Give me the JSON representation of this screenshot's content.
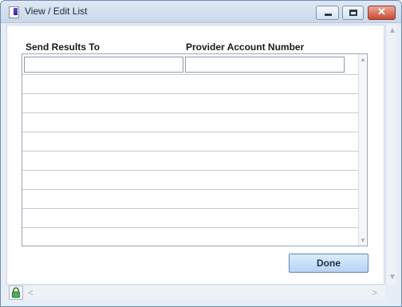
{
  "window": {
    "title": "View / Edit List",
    "close_glyph": "✕"
  },
  "grid": {
    "columns": [
      "Send Results To",
      "Provider Account Number"
    ],
    "row1": {
      "send_results_to": "",
      "provider_account_number": ""
    }
  },
  "actions": {
    "done_label": "Done"
  },
  "scroll": {
    "up": "▲",
    "down": "▼",
    "left": "<",
    "right": ">"
  }
}
